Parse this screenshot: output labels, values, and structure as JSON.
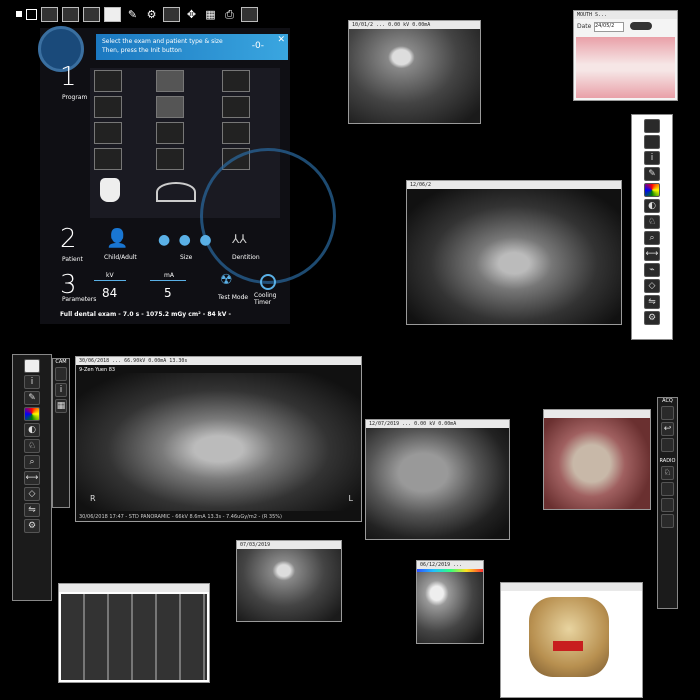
{
  "toolbar": {
    "icons": [
      "record-icon",
      "square-icon",
      "image-icon",
      "edit-icon",
      "scanner-icon",
      "camera-icon",
      "pen-icon",
      "gear-icon",
      "transfer-icon",
      "move-icon",
      "grid-icon",
      "print-icon",
      "layout-icon"
    ]
  },
  "acq": {
    "instructions_line1": "Select the exam and patient type & size",
    "instructions_line2": "Then, press the Init button",
    "init_value": "-0-",
    "step1": "1",
    "step1_label": "Program",
    "step2": "2",
    "step2_label": "Patient",
    "child_adult": "Child/Adult",
    "size": "Size",
    "dentition": "Dentition",
    "step3": "3",
    "step3_label": "Parameters",
    "kv_label": "kV",
    "kv_value": "84",
    "ma_label": "mA",
    "ma_value": "5",
    "test_mode": "Test Mode",
    "cooling_timer": "Cooling Timer",
    "summary": "Full dental exam - 7.0 s - 1075.2 mGy cm² - 84 kV -"
  },
  "windows": {
    "bitewing_top": {
      "title": "10/01/2 ...  0.00 kV  0.00mA"
    },
    "mouth": {
      "title": "MOUTH S...",
      "date_label": "Date",
      "date_value": "24/05/2"
    },
    "pano_right": {
      "title": "12/06/2"
    },
    "pano_main": {
      "title": "30/06/2018 ... 66.90kV  0.00mA  13.30s",
      "subtitle": "9-Zen Yuen 83",
      "footer": "30/06/2018 17:47 - STD PANORAMIC - 66kV 8.6mA 13.3s - 7.46uGy/m2 - (R 35%)",
      "left_marker": "R",
      "right_marker": "L"
    },
    "ceph": {
      "title": "12/07/2019 ... 0.00 kV 0.00mA"
    },
    "photo": {
      "title": ""
    },
    "bw_bottom": {
      "title": "07/03/2019"
    },
    "periapical": {
      "title": "06/12/2019 ..."
    },
    "cbct_views": {
      "title": ""
    },
    "cbct_3d": {
      "title": ""
    }
  },
  "left_panel": {
    "header": "CAM"
  },
  "right_panel_bottom": {
    "header": "ACQ",
    "section": "RADIO"
  }
}
